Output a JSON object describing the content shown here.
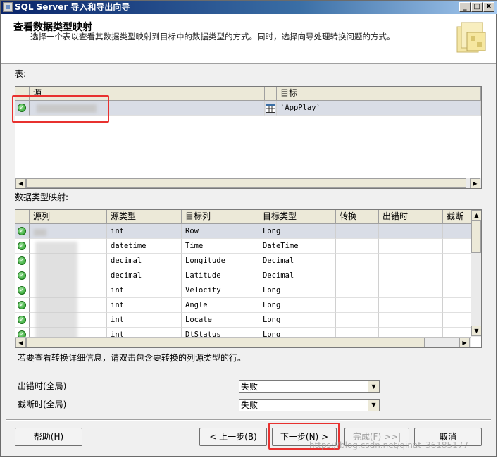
{
  "window": {
    "title": "SQL Server 导入和导出向导",
    "controls": [
      "_",
      "□",
      "X"
    ]
  },
  "header": {
    "title": "查看数据类型映射",
    "subtitle": "选择一个表以查看其数据类型映射到目标中的数据类型的方式。同时，选择向导处理转换问题的方式。"
  },
  "tables_section": {
    "label": "表:",
    "columns": [
      "源",
      "目标"
    ],
    "rows": [
      {
        "source": "",
        "target": "`AppPlay`",
        "selected": true
      }
    ]
  },
  "mapping_section": {
    "label": "数据类型映射:",
    "columns": [
      "源列",
      "源类型",
      "目标列",
      "目标类型",
      "转换",
      "出错时",
      "截断时"
    ],
    "rows": [
      {
        "source_col": "",
        "source_type": "int",
        "target_col": "Row",
        "target_type": "Long"
      },
      {
        "source_col": "",
        "source_type": "datetime",
        "target_col": "Time",
        "target_type": "DateTime"
      },
      {
        "source_col": "",
        "source_type": "decimal",
        "target_col": "Longitude",
        "target_type": "Decimal"
      },
      {
        "source_col": "",
        "source_type": "decimal",
        "target_col": "Latitude",
        "target_type": "Decimal"
      },
      {
        "source_col": "",
        "source_type": "int",
        "target_col": "Velocity",
        "target_type": "Long"
      },
      {
        "source_col": "",
        "source_type": "int",
        "target_col": "Angle",
        "target_type": "Long"
      },
      {
        "source_col": "",
        "source_type": "int",
        "target_col": "Locate",
        "target_type": "Long"
      },
      {
        "source_col": "",
        "source_type": "int",
        "target_col": "DtStatus",
        "target_type": "Long"
      }
    ]
  },
  "hint": "若要查看转换详细信息，请双击包含要转换的列源类型的行。",
  "global_settings": {
    "on_error_label": "出错时(全局)",
    "on_error_value": "失败",
    "on_truncate_label": "截断时(全局)",
    "on_truncate_value": "失败"
  },
  "buttons": {
    "help": "帮助(H)",
    "back": "< 上一步(B)",
    "next": "下一步(N) >",
    "finish": "完成(F) >>|",
    "cancel": "取消"
  },
  "watermark": "https://blog.csdn.net/qinat_36185177",
  "colors": {
    "highlight_box": "#e8312f",
    "selected_row": "#d9dde6",
    "titlebar": "#0a246a"
  }
}
